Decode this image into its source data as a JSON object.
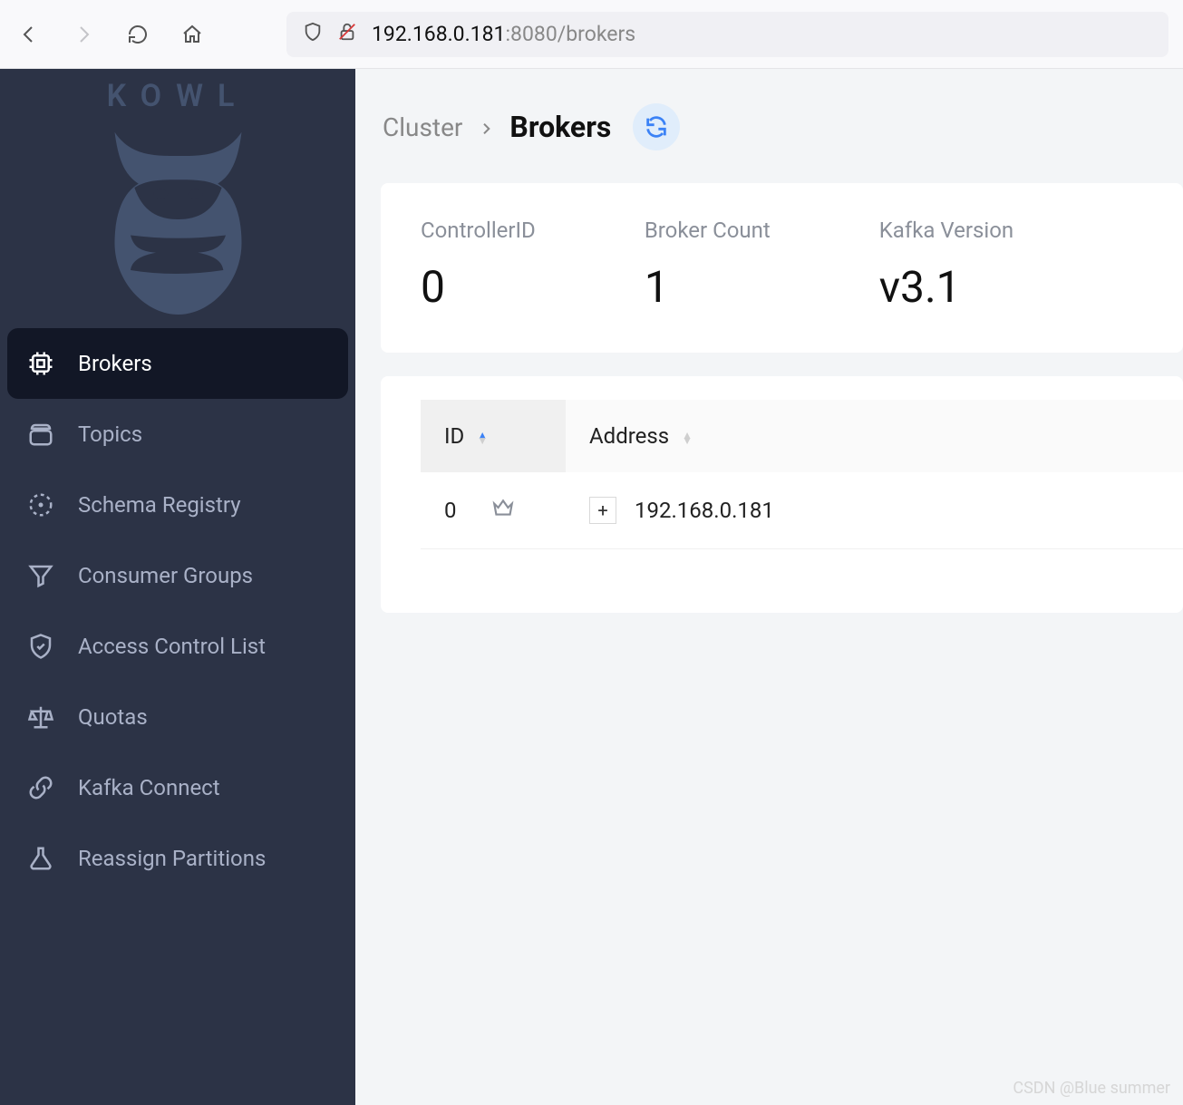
{
  "browser": {
    "url_host": "192.168.0.181",
    "url_path": ":8080/brokers"
  },
  "sidebar": {
    "brand": "KOWL",
    "items": [
      {
        "label": "Brokers",
        "active": true
      },
      {
        "label": "Topics",
        "active": false
      },
      {
        "label": "Schema Registry",
        "active": false
      },
      {
        "label": "Consumer Groups",
        "active": false
      },
      {
        "label": "Access Control List",
        "active": false
      },
      {
        "label": "Quotas",
        "active": false
      },
      {
        "label": "Kafka Connect",
        "active": false
      },
      {
        "label": "Reassign Partitions",
        "active": false
      }
    ]
  },
  "breadcrumb": {
    "parent": "Cluster",
    "current": "Brokers"
  },
  "stats": {
    "controller_id": {
      "label": "ControllerID",
      "value": "0"
    },
    "broker_count": {
      "label": "Broker Count",
      "value": "1"
    },
    "kafka_version": {
      "label": "Kafka Version",
      "value": "v3.1"
    }
  },
  "table": {
    "columns": {
      "id": "ID",
      "address": "Address"
    },
    "rows": [
      {
        "id": "0",
        "is_controller": true,
        "address": "192.168.0.181"
      }
    ]
  },
  "watermark": "CSDN @Blue summer"
}
